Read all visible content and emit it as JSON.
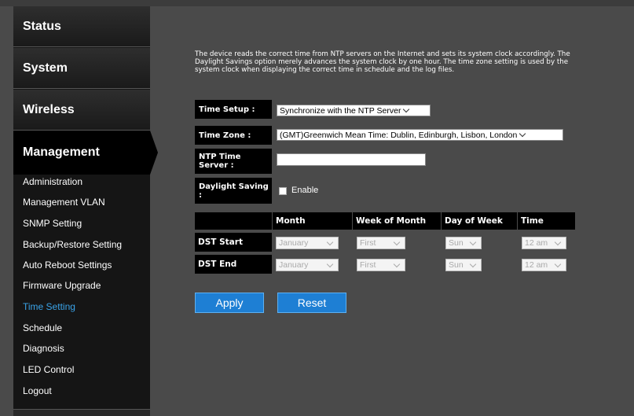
{
  "sidebar": {
    "sections": {
      "status": "Status",
      "system": "System",
      "wireless": "Wireless",
      "management": "Management"
    },
    "items": [
      {
        "label": "Administration"
      },
      {
        "label": "Management VLAN"
      },
      {
        "label": "SNMP Setting"
      },
      {
        "label": "Backup/Restore Setting"
      },
      {
        "label": "Auto Reboot Settings"
      },
      {
        "label": "Firmware Upgrade"
      },
      {
        "label": "Time Setting"
      },
      {
        "label": "Schedule"
      },
      {
        "label": "Diagnosis"
      },
      {
        "label": "LED Control"
      },
      {
        "label": "Logout"
      }
    ],
    "active_item": "Time Setting"
  },
  "main": {
    "description": "The device reads the correct time from NTP servers on the Internet and sets its system clock accordingly. The Daylight Savings option merely advances the system clock by one hour. The time zone setting is used by the system clock when displaying the correct time in schedule and the log files.",
    "time_setup": {
      "label": "Time Setup :",
      "value": "Synchronize with the NTP Server"
    },
    "time_zone": {
      "label": "Time Zone :",
      "value": "(GMT)Greenwich Mean Time: Dublin, Edinburgh, Lisbon, London"
    },
    "ntp_server": {
      "label": "NTP Time Server :",
      "value": ""
    },
    "daylight_saving": {
      "label": "Daylight Saving :",
      "checkbox_label": "Enable",
      "checked": false
    },
    "dst_table": {
      "headers": [
        "Month",
        "Week of Month",
        "Day of Week",
        "Time"
      ],
      "rows": [
        {
          "label": "DST Start",
          "month": "January",
          "week": "First",
          "day": "Sun",
          "time": "12 am"
        },
        {
          "label": "DST End",
          "month": "January",
          "week": "First",
          "day": "Sun",
          "time": "12 am"
        }
      ]
    },
    "buttons": {
      "apply": "Apply",
      "reset": "Reset"
    }
  },
  "colors": {
    "background": "#4a4a4a",
    "sidebar": "#151515",
    "active_link": "#3aa3e8",
    "button": "#1e7fd4"
  }
}
